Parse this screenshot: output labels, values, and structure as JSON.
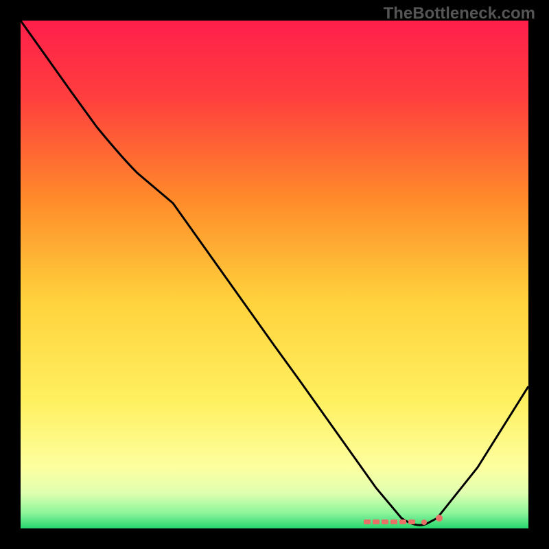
{
  "watermark": "TheBottleneck.com",
  "chart_data": {
    "type": "line",
    "title": "",
    "xlabel": "",
    "ylabel": "",
    "xlim": [
      0,
      100
    ],
    "ylim": [
      0,
      100
    ],
    "series": [
      {
        "name": "curve",
        "x": [
          0,
          5,
          10,
          15,
          20,
          25,
          30,
          35,
          40,
          45,
          50,
          55,
          60,
          65,
          70,
          75,
          78,
          82,
          90,
          100
        ],
        "values": [
          100,
          93,
          86,
          79,
          73,
          70,
          64,
          57,
          50,
          43,
          36,
          29,
          22,
          15,
          8,
          2,
          0,
          2,
          12,
          28
        ]
      }
    ],
    "markers": {
      "comment": "dashed cluster near the valley bottom",
      "x": [
        68,
        70,
        71,
        72,
        73,
        74,
        75,
        76,
        79,
        82
      ],
      "y": [
        1,
        1,
        1,
        1,
        1,
        1,
        1,
        1,
        1,
        1.5
      ]
    },
    "gradient_stops": [
      {
        "pct": 0,
        "color": "#ff1f4b"
      },
      {
        "pct": 15,
        "color": "#ff3e3e"
      },
      {
        "pct": 35,
        "color": "#ff8a2a"
      },
      {
        "pct": 55,
        "color": "#ffd23c"
      },
      {
        "pct": 75,
        "color": "#fff060"
      },
      {
        "pct": 88,
        "color": "#fdffa0"
      },
      {
        "pct": 93,
        "color": "#e0ffb0"
      },
      {
        "pct": 97,
        "color": "#8cf59a"
      },
      {
        "pct": 100,
        "color": "#27d66e"
      }
    ]
  }
}
